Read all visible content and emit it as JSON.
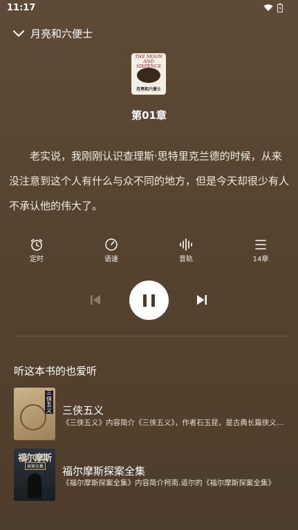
{
  "status_bar": {
    "time": "11:17"
  },
  "header": {
    "title": "月亮和六便士"
  },
  "book": {
    "cover_title_top": "THE MOON AND SIXPENCE",
    "cover_title_bottom": "月亮和六便士",
    "chapter": "第01章"
  },
  "text": {
    "paragraph": "老实说，我刚刚认识查理斯·思特里克兰德的时候，从来没注意到这个人有什么与众不同的地方，但是今天却很少有人不承认他的伟大了。"
  },
  "controls": {
    "timer_label": "定时",
    "speed_label": "语速",
    "voice_label": "音轨",
    "chapters_label": "14章"
  },
  "recommend": {
    "section_title": "听这本书的也爱听",
    "items": [
      {
        "title": "三侠五义",
        "desc": "《三侠五义》内容简介《三侠五义》，作者石玉昆，是古典长篇侠义公案小说。",
        "cover_text": "三侠五义"
      },
      {
        "title": "福尔摩斯探案全集",
        "desc": "《福尔摩斯探案全集》内容简介柯南.道尔的《福尔摩斯探案全集》",
        "cover_text": "福尔摩斯",
        "cover_subtext": "探案全集"
      }
    ]
  },
  "colors": {
    "background": "#5a4632",
    "play_button": "#ffffff"
  }
}
